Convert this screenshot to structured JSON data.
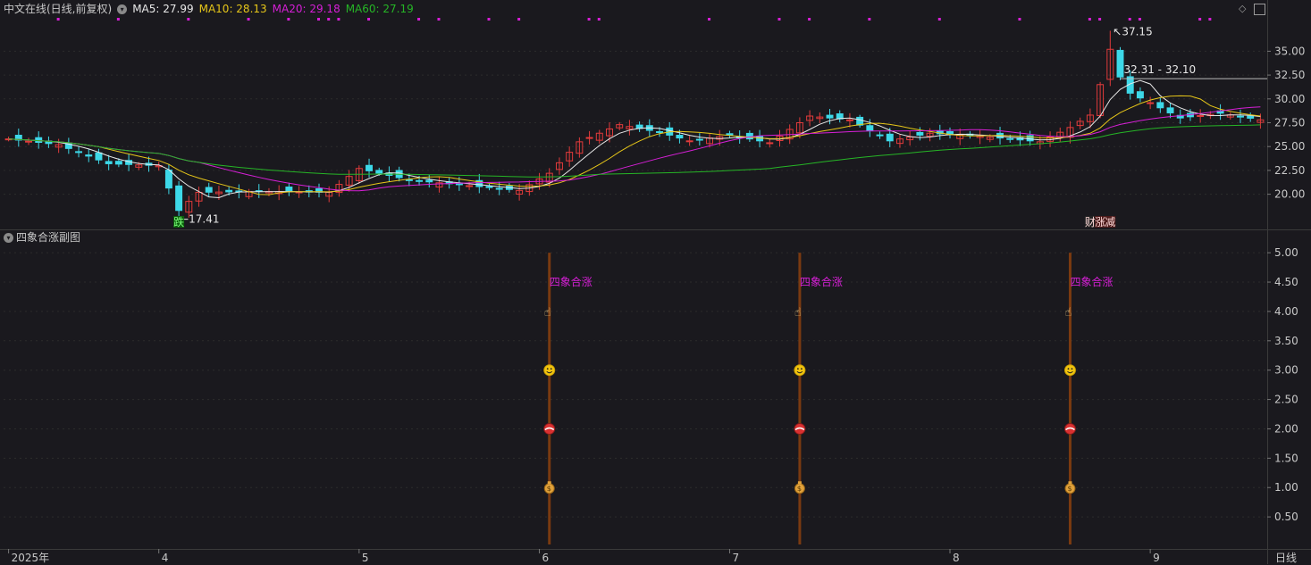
{
  "header": {
    "title": "中文在线(日线,前复权)",
    "ma": [
      {
        "label": "MA5: 27.99",
        "color": "#e8e8e8"
      },
      {
        "label": "MA10: 28.13",
        "color": "#e6c619"
      },
      {
        "label": "MA20: 29.18",
        "color": "#d61fd6"
      },
      {
        "label": "MA60: 27.19",
        "color": "#26b526"
      }
    ]
  },
  "sub_title": "四象合涨副图",
  "period_label": "日线",
  "colors": {
    "background": "#1a191e",
    "up": "#e23b3b",
    "down": "#3dd8e8",
    "signal": "#d61fd6",
    "pillar": "#7a3a10"
  },
  "chart_data": [
    {
      "type": "candlestick",
      "title": "中文在线(日线,前复权)",
      "y_ticks": [
        "35.00",
        "32.50",
        "30.00",
        "27.50",
        "25.00",
        "22.50",
        "20.00"
      ],
      "ylim": [
        16.5,
        38.5
      ],
      "x_ticks": [
        {
          "label": "2025年",
          "index": 0
        },
        {
          "label": "4",
          "index": 15
        },
        {
          "label": "5",
          "index": 35
        },
        {
          "label": "6",
          "index": 53
        },
        {
          "label": "7",
          "index": 72
        },
        {
          "label": "8",
          "index": 94
        },
        {
          "label": "9",
          "index": 114
        }
      ],
      "num_bars": 126,
      "anchors": [
        {
          "i": 0,
          "c": 25.8
        },
        {
          "i": 5,
          "c": 25.2
        },
        {
          "i": 10,
          "c": 23.2
        },
        {
          "i": 15,
          "c": 23.0
        },
        {
          "i": 17,
          "c": 18.3
        },
        {
          "i": 19,
          "c": 20.2
        },
        {
          "i": 25,
          "c": 20.3
        },
        {
          "i": 32,
          "c": 20.2
        },
        {
          "i": 35,
          "c": 22.7
        },
        {
          "i": 40,
          "c": 21.5
        },
        {
          "i": 45,
          "c": 21.0
        },
        {
          "i": 51,
          "c": 20.4
        },
        {
          "i": 54,
          "c": 22.2
        },
        {
          "i": 57,
          "c": 25.5
        },
        {
          "i": 61,
          "c": 27.3
        },
        {
          "i": 65,
          "c": 26.5
        },
        {
          "i": 68,
          "c": 25.6
        },
        {
          "i": 72,
          "c": 26.2
        },
        {
          "i": 76,
          "c": 25.4
        },
        {
          "i": 80,
          "c": 28.2
        },
        {
          "i": 84,
          "c": 27.8
        },
        {
          "i": 88,
          "c": 25.6
        },
        {
          "i": 92,
          "c": 26.4
        },
        {
          "i": 97,
          "c": 26.1
        },
        {
          "i": 103,
          "c": 25.5
        },
        {
          "i": 106,
          "c": 27.0
        },
        {
          "i": 108,
          "c": 28.3
        },
        {
          "i": 109,
          "c": 31.5
        },
        {
          "i": 110,
          "c": 35.2
        },
        {
          "i": 111,
          "c": 32.3
        },
        {
          "i": 112,
          "c": 30.6
        },
        {
          "i": 114,
          "c": 29.6
        },
        {
          "i": 117,
          "c": 28.0
        },
        {
          "i": 121,
          "c": 28.5
        },
        {
          "i": 125,
          "c": 27.8
        }
      ],
      "ma_last": {
        "MA5": 27.99,
        "MA10": 28.13,
        "MA20": 29.18,
        "MA60": 27.19
      },
      "annotations": [
        {
          "text": "17.41",
          "index": 17,
          "value": 17.41
        },
        {
          "text": "37.15",
          "index": 110,
          "value": 37.15
        },
        {
          "text": "32.31 - 32.10",
          "index": 111,
          "value": 32.31
        }
      ],
      "markers": [
        {
          "text": "跌",
          "index": 17
        },
        {
          "text": "财",
          "index": 108
        },
        {
          "text": "涨",
          "index": 109
        },
        {
          "text": "减",
          "index": 110
        }
      ],
      "top_marker_indices": [
        5,
        11,
        18,
        24,
        28,
        31,
        32,
        33,
        36,
        41,
        43,
        48,
        51,
        58,
        59,
        70,
        77,
        80,
        86,
        93,
        101,
        108,
        109,
        112,
        113,
        119,
        120
      ]
    },
    {
      "type": "signal",
      "title": "四象合涨副图",
      "y_ticks": [
        "5.00",
        "4.50",
        "4.00",
        "3.50",
        "3.00",
        "2.50",
        "2.00",
        "1.50",
        "1.00",
        "0.50"
      ],
      "ylim": [
        0,
        5.2
      ],
      "signal_label": "四象合涨",
      "signals": [
        {
          "index": 54
        },
        {
          "index": 79
        },
        {
          "index": 106
        }
      ],
      "icon_levels": [
        {
          "level": 4.0,
          "icon": "hand-pointer-icon"
        },
        {
          "level": 3.0,
          "icon": "smiley-icon"
        },
        {
          "level": 2.0,
          "icon": "ball-icon"
        },
        {
          "level": 1.0,
          "icon": "money-bag-icon"
        }
      ]
    }
  ]
}
